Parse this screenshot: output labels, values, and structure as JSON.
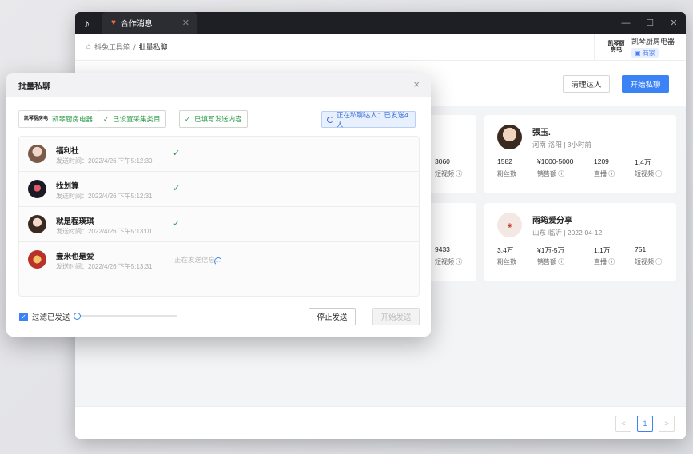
{
  "app": {
    "tab_title": "合作消息",
    "breadcrumb": {
      "root": "抖兔工具箱",
      "sep": "/",
      "current": "批量私聊"
    },
    "shop": {
      "logo_text": "凯琴厨房电",
      "name": "凯琴厨房电器",
      "tag": "商家"
    },
    "toolbar": {
      "clear_label": "清理达人",
      "start_label": "开始私聊"
    }
  },
  "cards": [
    {
      "name": "",
      "location": "",
      "stats": [
        "",
        "",
        "",
        "3060"
      ],
      "labels": [
        "",
        "",
        "",
        "短视频"
      ]
    },
    {
      "name": "張玉.",
      "location": "河南·洛阳 | 3小时前",
      "stats": [
        "1582",
        "¥1000-5000",
        "1209",
        "1.4万"
      ],
      "labels": [
        "粉丝数",
        "销售额",
        "直播",
        "短视频"
      ]
    },
    {
      "name": "",
      "location": "",
      "stats": [
        "",
        "",
        "",
        "9433"
      ],
      "labels": [
        "",
        "",
        "",
        "短视频"
      ]
    },
    {
      "name": "雨筠爱分享",
      "location": "山东·临沂 | 2022-04-12",
      "stats": [
        "3.4万",
        "¥1万-5万",
        "1.1万",
        "751"
      ],
      "labels": [
        "粉丝数",
        "销售额",
        "直播",
        "短视频"
      ]
    }
  ],
  "pagination": {
    "prev": "<",
    "current": "1",
    "next": ">"
  },
  "modal": {
    "title": "批量私聊",
    "close": "×",
    "shop_tag": "凯琴厨房电器",
    "shop_logo": "凯琴厨房电",
    "tag_category": "已设置采集类目",
    "tag_content": "已填写发送内容",
    "status": "正在私聊达人：已发送4人",
    "rows": [
      {
        "name": "福利社",
        "time": "发送时间：2022/4/26 下午5:12:30",
        "state": "✓"
      },
      {
        "name": "找划算",
        "time": "发送时间：2022/4/26 下午5:12:31",
        "state": "✓"
      },
      {
        "name": "就是程瑛琪",
        "time": "发送时间：2022/4/26 下午5:13:01",
        "state": "✓"
      },
      {
        "name": "壹米也是爱",
        "time": "发送时间：2022/4/26 下午5:13:31",
        "state": "正在发送信息..."
      }
    ],
    "filter_label": "过滤已发送",
    "filter_checked": true,
    "slider_level": 0,
    "stop_label": "停止发送",
    "start_label": "开始发送"
  },
  "colors": {
    "accent": "#3b82f6",
    "success": "#2e9a4b",
    "titlebar": "#1d1f24"
  }
}
